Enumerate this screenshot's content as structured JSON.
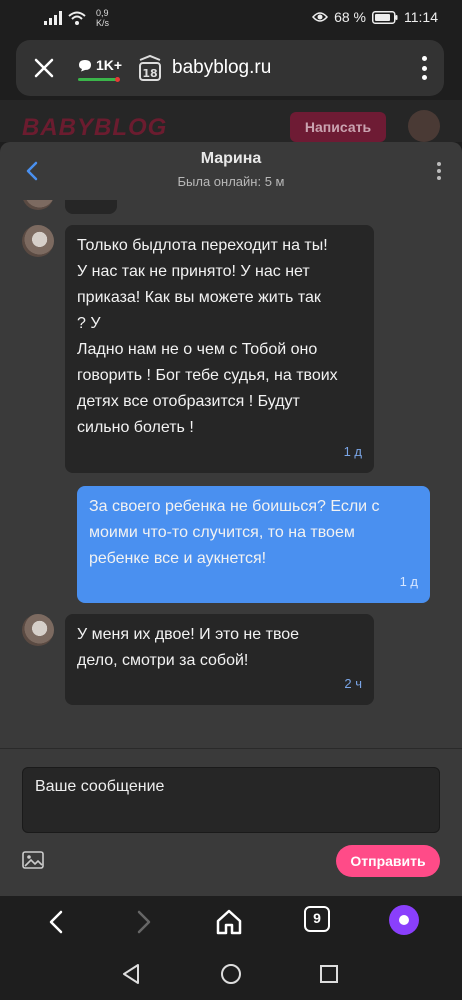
{
  "status_bar": {
    "net_speed_value": "0,9",
    "net_speed_unit": "K/s",
    "battery": "68 %",
    "time": "11:14"
  },
  "browser": {
    "counter": "1K+",
    "tabs_count": "18",
    "url": "babyblog.ru"
  },
  "site": {
    "logo": "BABYBLOG",
    "write_button": "Написать"
  },
  "chat": {
    "name": "Марина",
    "status": "Была онлайн: 5 м",
    "partial_time": "1 д",
    "messages": [
      {
        "direction": "in",
        "text": "Только быдлота переходит на ты!\nУ нас так не принято! У нас нет\nприказа! Как вы можете жить так\n? У\nЛадно нам не о чем с Тобой оно\nговорить ! Бог тебе судья, на твоих\nдетях все отобразится ! Будут\nсильно болеть !",
        "time": "1 д"
      },
      {
        "direction": "out",
        "text": "За своего ребенка не боишься? Если с\nмоими что-то случится, то на твоем\nребенке все и аукнется!",
        "time": "1 д"
      },
      {
        "direction": "in",
        "text": "У меня их двое! И это не твое\nдело, смотри за собой!",
        "time": "2 ч"
      }
    ]
  },
  "composer": {
    "placeholder": "Ваше сообщение",
    "send_label": "Отправить"
  },
  "bottom_nav": {
    "tabs_count": "9"
  },
  "colors": {
    "accent_send": "#ff4b88",
    "outgoing_bubble": "#4a90f0",
    "incoming_bubble": "#262626",
    "chat_bg": "#3a3a3a"
  }
}
